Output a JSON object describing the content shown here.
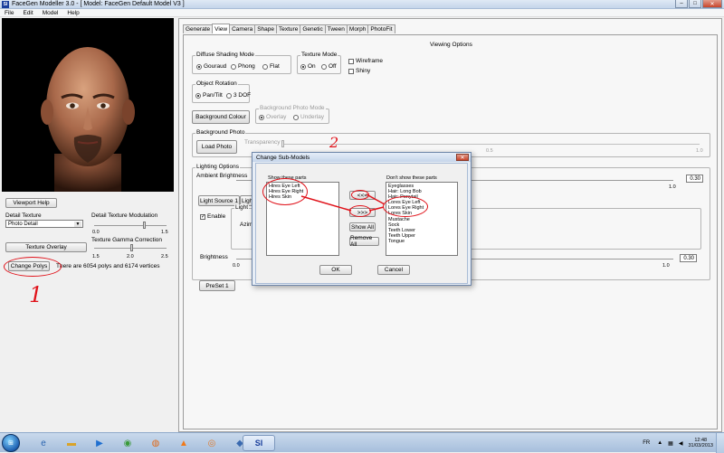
{
  "window": {
    "app_logo": "SI",
    "title": "FaceGen Modeller 3.0 - [ Model: FaceGen Default Model V3 ]",
    "minimize": "‒",
    "maximize": "□",
    "close": "✕"
  },
  "menu": [
    "File",
    "Edit",
    "Model",
    "Help"
  ],
  "left": {
    "viewport_help": "Viewport Help",
    "detail_texture_label": "Detail Texture",
    "detail_texture_value": "Photo Detail",
    "detail_mod_label": "Detail Texture Modulation",
    "detail_mod_min": "0.0",
    "detail_mod_max": "1.5",
    "texture_overlay": "Texture Overlay",
    "gamma_label": "Texture Gamma Correction",
    "gamma_min": "1.5",
    "gamma_mid": "2.0",
    "gamma_max": "2.5",
    "change_polys": "Change Polys",
    "poly_info": "There are 6054 polys and 6174 vertices"
  },
  "tabs": [
    "Generate",
    "View",
    "Camera",
    "Shape",
    "Texture",
    "Genetic",
    "Tween",
    "Morph",
    "PhotoFit"
  ],
  "active_tab": "View",
  "view": {
    "heading": "Viewing Options",
    "shading_title": "Diffuse Shading Mode",
    "shading_options": [
      "Gouraud",
      "Phong",
      "Flat"
    ],
    "texture_title": "Texture Mode",
    "texture_options": [
      "On",
      "Off"
    ],
    "wireframe": "Wireframe",
    "shiny": "Shiny",
    "rotation_title": "Object Rotation",
    "rotation_options": [
      "Pan/Tilt",
      "3 DOF"
    ],
    "background_colour": "Background Colour",
    "bg_photo_mode_title": "Background Photo Mode",
    "bg_photo_mode_options": [
      "Overlay",
      "Underlay"
    ],
    "bg_photo_title": "Background Photo",
    "load_photo": "Load Photo",
    "transparency": "Transparency",
    "transparency_mid": "0.5",
    "transparency_max": "1.0",
    "lighting_title": "Lighting Options",
    "ambient": "Ambient Brightness",
    "ambient_min": "0.0",
    "ambient_max": "1.0",
    "ambient_value": "0.30",
    "light_source_1": "Light Source 1",
    "light_source_2": "Light Source 2",
    "enable": "Enable",
    "light_group": "Light",
    "azimuth": "Azim",
    "brightness": "Brightness",
    "brightness_min": "0.0",
    "brightness_max": "1.0",
    "brightness_value": "0.30",
    "preset": "PreSet 1"
  },
  "dialog": {
    "title": "Change Sub-Models",
    "close": "✕",
    "show_label": "Show these parts",
    "hide_label": "Don't show these parts",
    "shown": [
      "Hires Eye Left",
      "Hires Eye Right",
      "Hires Skin"
    ],
    "hidden": [
      "Eyeglasses",
      "Hair: Long Bob",
      "Hair: Ponytail",
      "Lores Eye Left",
      "Lores Eye Right",
      "Lores Skin",
      "Mustache",
      "Sock",
      "Teeth Lower",
      "Teeth Upper",
      "Tongue"
    ],
    "move_left": "<<<",
    "move_right": ">>>",
    "show_all": "Show All",
    "remove_all": "Remove All",
    "ok": "OK",
    "cancel": "Cancel"
  },
  "annotations": {
    "one": "1",
    "two": "2"
  },
  "taskbar": {
    "lang": "FR",
    "time": "12:48",
    "date": "31/03/2013",
    "si_label": "SI"
  },
  "colors": {
    "annotation": "#e0121a",
    "accent": "#1a3f9c"
  }
}
